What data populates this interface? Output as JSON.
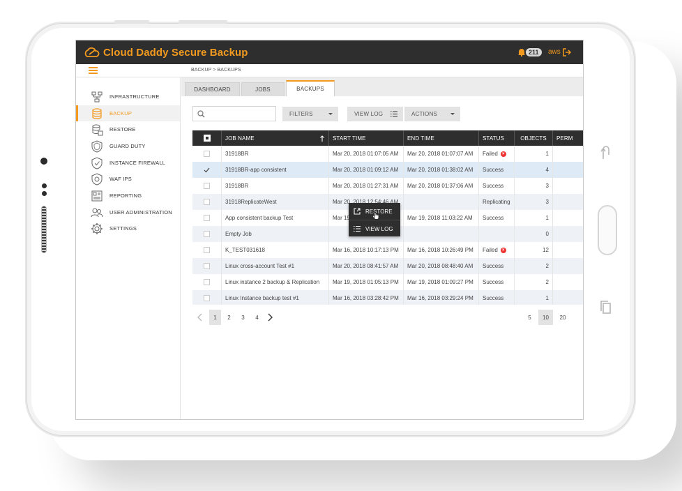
{
  "app": {
    "title": "Cloud Daddy Secure Backup",
    "notification_count": "211",
    "account": "aws",
    "breadcrumb": "BACKUP > BACKUPS",
    "accent_color": "#f29a1f",
    "topbar_color": "#2e2e2e"
  },
  "sidebar": {
    "items": [
      {
        "label": "INFRASTRUCTURE",
        "icon": "network-icon",
        "active": false
      },
      {
        "label": "BACKUP",
        "icon": "database-icon",
        "active": true
      },
      {
        "label": "RESTORE",
        "icon": "restore-icon",
        "active": false
      },
      {
        "label": "GUARD DUTY",
        "icon": "shield-icon",
        "active": false
      },
      {
        "label": "INSTANCE FIREWALL",
        "icon": "shield-check-icon",
        "active": false
      },
      {
        "label": "WAF IPS",
        "icon": "shield-waf-icon",
        "active": false
      },
      {
        "label": "REPORTING",
        "icon": "report-icon",
        "active": false
      },
      {
        "label": "USER ADMINISTRATION",
        "icon": "users-icon",
        "active": false
      },
      {
        "label": "SETTINGS",
        "icon": "gear-icon",
        "active": false
      }
    ]
  },
  "tabs": [
    {
      "label": "DASHBOARD",
      "active": false
    },
    {
      "label": "JOBS",
      "active": false
    },
    {
      "label": "BACKUPS",
      "active": true
    }
  ],
  "toolbar": {
    "search_placeholder": "",
    "filters_label": "FILTERS",
    "view_log_label": "VIEW LOG",
    "actions_label": "ACTIONS"
  },
  "table": {
    "columns": [
      "JOB NAME",
      "START TIME",
      "END TIME",
      "STATUS",
      "OBJECTS",
      "PERM"
    ],
    "rows": [
      {
        "job_name": "31918BR",
        "start": "Mar 20, 2018 01:07:05 AM",
        "end": "Mar 20, 2018 01:07:07 AM",
        "status": "Failed",
        "objects": "1",
        "checked": false
      },
      {
        "job_name": "31918BR-app consistent",
        "start": "Mar 20, 2018 01:09:12 AM",
        "end": "Mar 20, 2018 01:38:02 AM",
        "status": "Success",
        "objects": "4",
        "checked": true
      },
      {
        "job_name": "31918BR",
        "start": "Mar 20, 2018 01:27:31 AM",
        "end": "Mar 20, 2018 01:37:06 AM",
        "status": "Success",
        "objects": "3",
        "checked": false
      },
      {
        "job_name": "31918ReplicateWest",
        "start": "Mar 20, 2018 12:54:46 AM",
        "end": "",
        "status": "Replicating",
        "objects": "3",
        "checked": false
      },
      {
        "job_name": "App consistent backup Test",
        "start": "Mar 19, 2018 11:02:31 AM",
        "end": "Mar 19, 2018 11:03:22 AM",
        "status": "Success",
        "objects": "1",
        "checked": false
      },
      {
        "job_name": "Empty Job",
        "start": "",
        "end": "",
        "status": "",
        "objects": "0",
        "checked": false
      },
      {
        "job_name": "K_TEST031618",
        "start": "Mar 16, 2018 10:17:13 PM",
        "end": "Mar 16, 2018 10:26:49 PM",
        "status": "Failed",
        "objects": "12",
        "checked": false
      },
      {
        "job_name": "Linux cross-account Test #1",
        "start": "Mar 20, 2018 08:41:57 AM",
        "end": "Mar 20, 2018 08:48:40 AM",
        "status": "Success",
        "objects": "2",
        "checked": false
      },
      {
        "job_name": "Linux instance 2 backup & Replication",
        "start": "Mar 19, 2018 01:05:13 PM",
        "end": "Mar 19, 2018 01:09:27 PM",
        "status": "Success",
        "objects": "2",
        "checked": false
      },
      {
        "job_name": "Linux Instance backup test #1",
        "start": "Mar 16, 2018 03:28:42 PM",
        "end": "Mar 16, 2018 03:29:24 PM",
        "status": "Success",
        "objects": "1",
        "checked": false
      }
    ]
  },
  "context_menu": {
    "items": [
      {
        "label": "RESTORE",
        "icon": "external-link-icon"
      },
      {
        "label": "VIEW LOG",
        "icon": "list-icon"
      }
    ]
  },
  "pagination": {
    "pages": [
      "1",
      "2",
      "3",
      "4"
    ],
    "current_page": "1",
    "page_sizes": [
      "5",
      "10",
      "20"
    ],
    "current_page_size": "10"
  }
}
